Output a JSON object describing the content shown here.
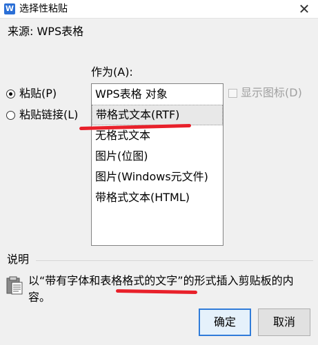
{
  "window": {
    "icon_letter": "W",
    "title": "选择性粘贴",
    "close_glyph": "✕"
  },
  "source": {
    "text": "来源: WPS表格"
  },
  "as_label": "作为(A):",
  "radio_options": [
    {
      "label": "粘贴(P)",
      "checked": true
    },
    {
      "label": "粘贴链接(L)",
      "checked": false
    }
  ],
  "formats": [
    {
      "label": "WPS表格 对象",
      "selected": false
    },
    {
      "label": "带格式文本(RTF)",
      "selected": true
    },
    {
      "label": "无格式文本",
      "selected": false
    },
    {
      "label": "图片(位图)",
      "selected": false
    },
    {
      "label": "图片(Windows元文件)",
      "selected": false
    },
    {
      "label": "带格式文本(HTML)",
      "selected": false
    }
  ],
  "show_icon": {
    "label": "显示图标(D)",
    "checked": false,
    "disabled": true
  },
  "description": {
    "label": "说明",
    "text": "以“带有字体和表格格式的文字”的形式插入剪贴板的内容。"
  },
  "buttons": {
    "ok": "确定",
    "cancel": "取消"
  },
  "colors": {
    "annotation_red": "#e8202a",
    "default_button_border": "#2f7bd9"
  }
}
